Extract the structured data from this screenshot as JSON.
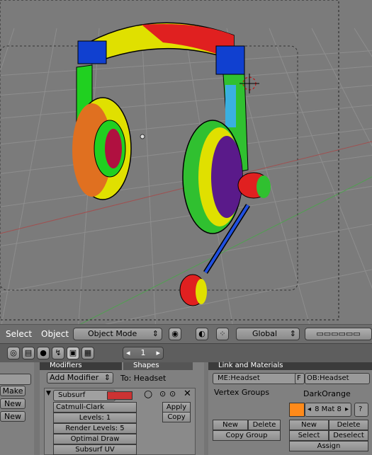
{
  "viewport": {
    "background": "#7b7b7b",
    "grid_color": "#8a8a8a",
    "object_name": "Headset"
  },
  "header3d": {
    "menu_select": "Select",
    "menu_object": "Object",
    "mode_label": "Object Mode",
    "orientation_label": "Global"
  },
  "buttons_header": {
    "frame_value": "1"
  },
  "editing": {
    "left_labels": [
      "Make",
      "New",
      "New"
    ],
    "tab_modifiers": "Modifiers",
    "tab_shapes": "Shapes",
    "add_modifier": "Add Modifier",
    "to_label": "To: Headset",
    "modifier_name": "Subsurf",
    "subsurf_type": "Catmull-Clark",
    "levels": "Levels: 1",
    "render_levels": "Render Levels: 5",
    "optimal_draw": "Optimal Draw",
    "subsurf_uv": "Subsurf UV",
    "apply": "Apply",
    "copy": "Copy"
  },
  "link_materials": {
    "title": "Link and Materials",
    "mesh_name": "ME:Headset",
    "f_label": "F",
    "object_name": "OB:Headset",
    "vertex_groups": "Vertex Groups",
    "material_name": "DarkOrange",
    "material_color": "#ff8a1a",
    "material_slot": "8 Mat 8",
    "question": "?",
    "vg_new": "New",
    "vg_delete": "Delete",
    "copy_group": "Copy Group",
    "mat_new": "New",
    "mat_delete": "Delete",
    "mat_select": "Select",
    "mat_deselect": "Deselect",
    "assign": "Assign"
  }
}
